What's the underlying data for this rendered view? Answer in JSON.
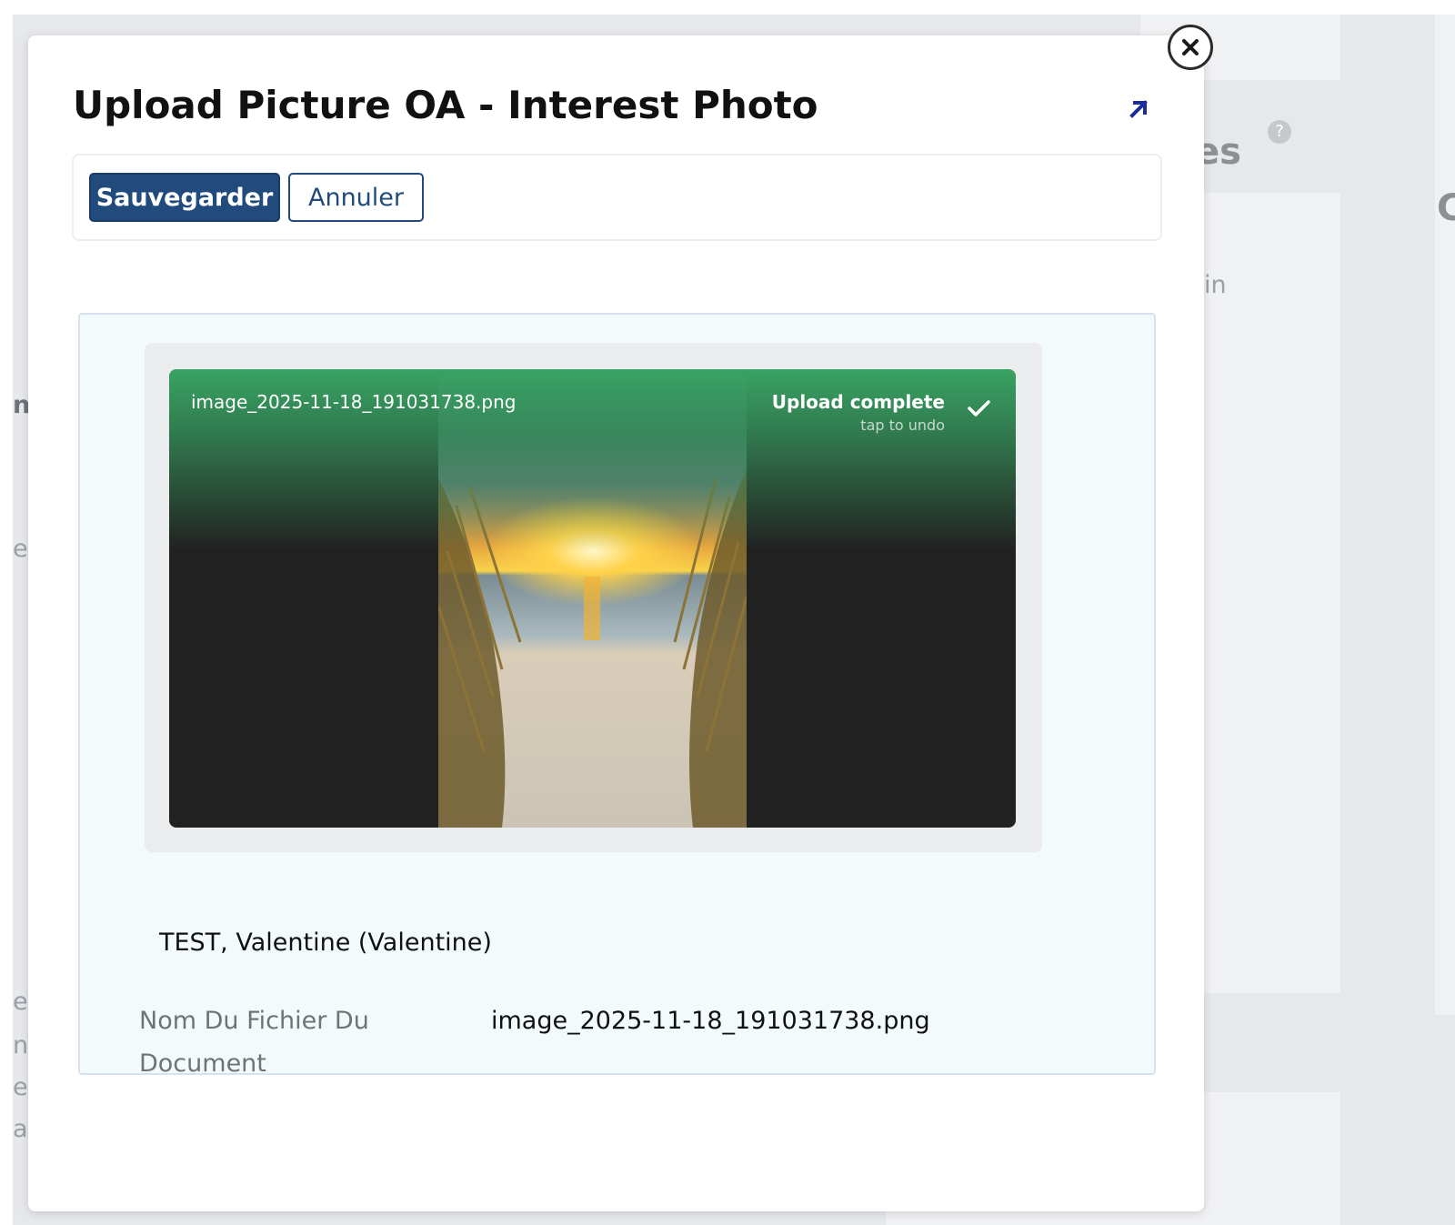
{
  "background": {
    "heading_fragment": "es",
    "text_in": "in",
    "heading_right": "C",
    "left_letters": [
      "nf",
      "e",
      "e",
      "n",
      "e",
      "a"
    ]
  },
  "modal": {
    "title": "Upload Picture OA - Interest Photo",
    "toolbar": {
      "save_label": "Sauvegarder",
      "cancel_label": "Annuler"
    },
    "upload": {
      "file_name": "image_2025-11-18_191031738.png",
      "status": "Upload complete",
      "status_hint": "tap to undo"
    },
    "person_name": "TEST, Valentine (Valentine)",
    "fields": [
      {
        "label": "Nom Du Fichier Du Document",
        "value": "image_2025-11-18_191031738.png"
      }
    ]
  },
  "colors": {
    "primary": "#224b7d",
    "success_green": "#38a363",
    "panel_bg": "#f3fafb"
  }
}
